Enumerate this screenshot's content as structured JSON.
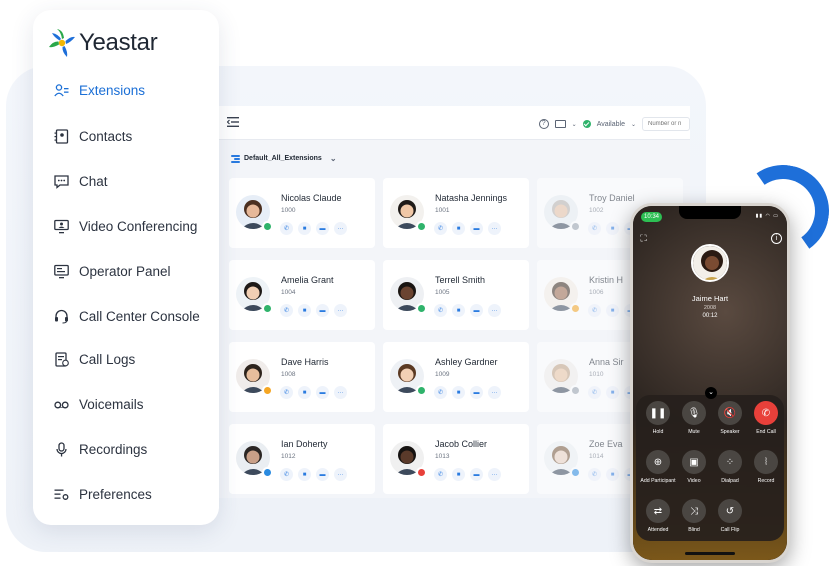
{
  "brand": {
    "name": "Yeastar"
  },
  "sidebar": {
    "items": [
      {
        "label": "Extensions",
        "icon": "extensions-icon",
        "active": true
      },
      {
        "label": "Contacts",
        "icon": "contacts-icon"
      },
      {
        "label": "Chat",
        "icon": "chat-icon"
      },
      {
        "label": "Video Conferencing",
        "icon": "video-conferencing-icon"
      },
      {
        "label": "Operator Panel",
        "icon": "operator-panel-icon"
      },
      {
        "label": "Call Center Console",
        "icon": "headset-icon"
      },
      {
        "label": "Call Logs",
        "icon": "call-logs-icon"
      },
      {
        "label": "Voicemails",
        "icon": "voicemail-icon"
      },
      {
        "label": "Recordings",
        "icon": "microphone-icon"
      },
      {
        "label": "Preferences",
        "icon": "preferences-icon"
      }
    ]
  },
  "topbar": {
    "help": "?",
    "status": "Available",
    "search_placeholder": "Number or n"
  },
  "group": {
    "selected": "Default_All_Extensions"
  },
  "extensions": [
    {
      "name": "Nicolas Claude",
      "ext": "1000",
      "status": "available"
    },
    {
      "name": "Natasha Jennings",
      "ext": "1001",
      "status": "available"
    },
    {
      "name": "Troy Daniel",
      "ext": "1002",
      "status": "offline"
    },
    {
      "name": "Amelia Grant",
      "ext": "1004",
      "status": "available"
    },
    {
      "name": "Terrell Smith",
      "ext": "1005",
      "status": "available"
    },
    {
      "name": "Kristin H",
      "ext": "1006",
      "status": "away"
    },
    {
      "name": "Dave Harris",
      "ext": "1008",
      "status": "away"
    },
    {
      "name": "Ashley Gardner",
      "ext": "1009",
      "status": "available"
    },
    {
      "name": "Anna Sir",
      "ext": "1010",
      "status": "offline"
    },
    {
      "name": "Ian Doherty",
      "ext": "1012",
      "status": "busy-blue"
    },
    {
      "name": "Jacob Collier",
      "ext": "1013",
      "status": "dnd"
    },
    {
      "name": "Zoe Eva",
      "ext": "1014",
      "status": "busy-blue"
    }
  ],
  "colors": {
    "accent": "#1b6fd6",
    "available": "#2fb36b",
    "away": "#f5a623",
    "dnd": "#e8403a",
    "offline": "#9aa3ad",
    "busy": "#2a8be0"
  },
  "phone": {
    "time": "10:34",
    "caller_name": "Jaime Hart",
    "caller_ext": "2008",
    "duration": "00:12",
    "controls": [
      {
        "label": "Hold",
        "icon": "pause-icon"
      },
      {
        "label": "Mute",
        "icon": "mute-icon"
      },
      {
        "label": "Speaker",
        "icon": "speaker-off-icon"
      },
      {
        "label": "End Call",
        "icon": "end-call-icon"
      },
      {
        "label": "Add Participant",
        "icon": "add-participant-icon"
      },
      {
        "label": "Video",
        "icon": "video-off-icon"
      },
      {
        "label": "Dialpad",
        "icon": "dialpad-icon"
      },
      {
        "label": "Record",
        "icon": "record-icon"
      },
      {
        "label": "Attended",
        "icon": "attended-transfer-icon"
      },
      {
        "label": "Blind",
        "icon": "blind-transfer-icon"
      },
      {
        "label": "Call Flip",
        "icon": "call-flip-icon"
      }
    ]
  }
}
